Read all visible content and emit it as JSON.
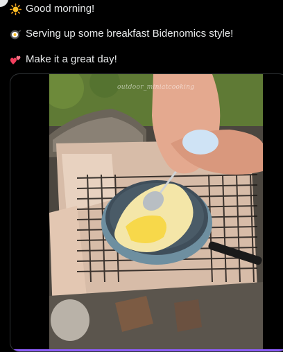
{
  "tweet": {
    "lines": [
      {
        "emoji": "sun-emoji",
        "text": "Good morning!"
      },
      {
        "emoji": "frying-pan-emoji",
        "text": "Serving up some breakfast Bidenomics style!"
      },
      {
        "emoji": "two-hearts-emoji",
        "text": "Make it a great day!"
      }
    ]
  },
  "media": {
    "type": "video",
    "watermark": "outdoor_miniatcooking",
    "progress": 1.0,
    "progress_color": "#8b5cf6"
  },
  "colors": {
    "background": "#000000",
    "text": "#e7e9ea",
    "card_border": "#2f3336"
  }
}
